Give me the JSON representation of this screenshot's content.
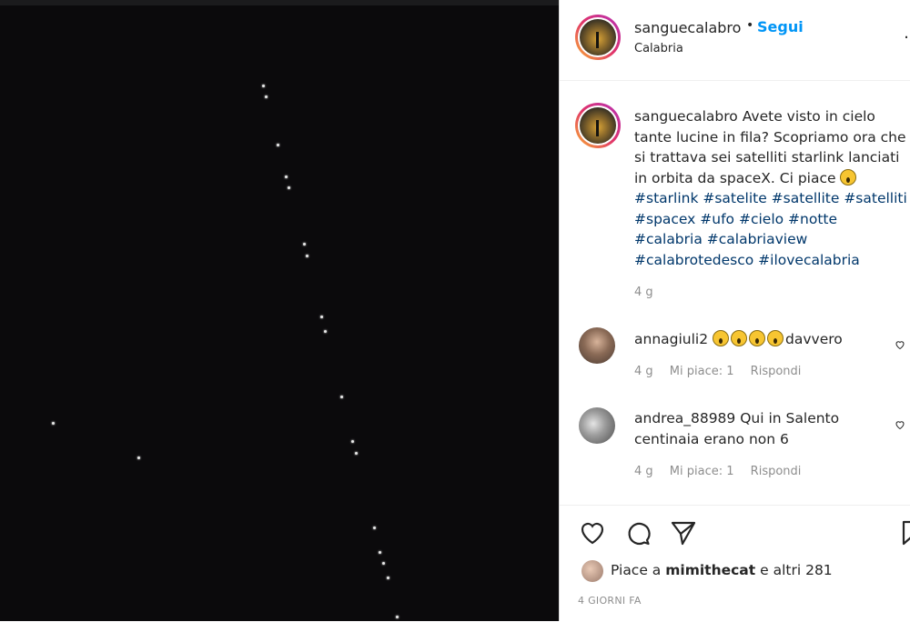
{
  "post": {
    "author": "sanguecalabro",
    "follow_label": "Segui",
    "separator": "•",
    "location": "Calabria",
    "more_label": "…",
    "caption_text": "Avete visto in cielo tante lucine in fila? Scopriamo ora che si trattava sei satelliti starlink lanciati in orbita da spaceX. Ci piace",
    "hashtags": "#starlink #satelite #satellite #satelliti #spacex #ufo #cielo #notte #calabria #calabriaview #calabrotedesco #ilovecalabria",
    "caption_time": "4 g"
  },
  "comments": [
    {
      "user": "annagiuli2",
      "text": "davvero",
      "time": "4 g",
      "likes": "Mi piace: 1",
      "reply": "Rispondi"
    },
    {
      "user": "andrea_88989",
      "text": "Qui in Salento centinaia erano non 6",
      "time": "4 g",
      "likes": "Mi piace: 1",
      "reply": "Rispondi"
    }
  ],
  "actions": {
    "like_icon": "heart-icon",
    "comment_icon": "comment-icon",
    "share_icon": "share-icon",
    "save_icon": "bookmark-icon"
  },
  "likes_line": {
    "prefix": "Piace a",
    "user": "mimithecat",
    "suffix": "e altri 281"
  },
  "date": "4 GIORNI FA",
  "colors": {
    "link_blue": "#0095f6",
    "hashtag": "#00376b",
    "muted": "#8e8e8e"
  }
}
